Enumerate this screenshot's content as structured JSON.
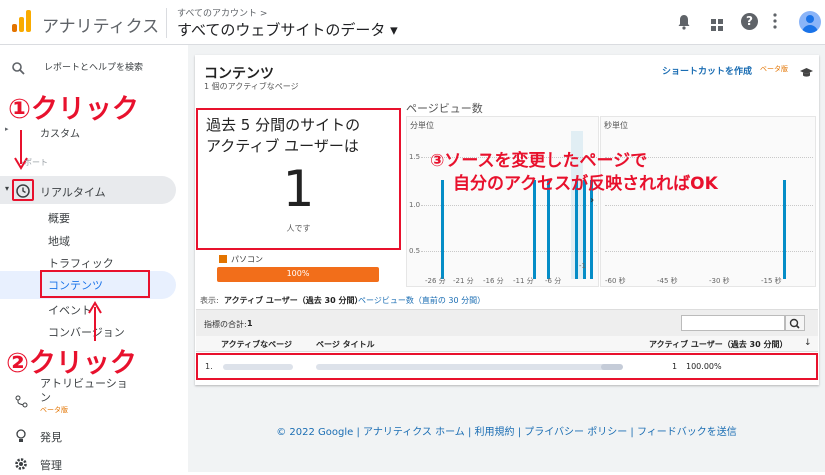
{
  "header": {
    "app_name": "アナリティクス",
    "account_path": "すべてのアカウント >",
    "property_name": "すべてのウェブサイトのデータ ▾"
  },
  "sidebar": {
    "search_label": "レポートとヘルプを検索",
    "custom_label": "カスタム",
    "report_section": "レポート",
    "realtime_label": "リアルタイム",
    "items": [
      "概要",
      "地域",
      "トラフィック",
      "コンテンツ",
      "イベント",
      "コンバージョン"
    ],
    "attribution_label": "アトリビューション",
    "beta_badge": "ベータ版",
    "discover_label": "発見",
    "admin_label": "管理"
  },
  "annotations": {
    "click1": "①クリック",
    "click2": "②クリック",
    "note3_line1": "③ソースを変更したページで",
    "note3_line2": "自分のアクセスが反映されればOK"
  },
  "content": {
    "title": "コンテンツ",
    "subtitle": "1 個のアクティブなページ",
    "shortcut_label": "ショートカットを作成",
    "shortcut_beta": "ベータ版",
    "active_box_line1": "過去 5 分間のサイトの",
    "active_box_line2": "アクティブ ユーザーは",
    "active_count": "1",
    "active_unit": "人です",
    "device_label": "パソコン",
    "device_percent": "100%",
    "pageview_title": "ページビュー数",
    "chart_min_label": "分単位",
    "chart_sec_label": "秒単位",
    "min_yticks": [
      "1.5",
      "1.0",
      "0.5"
    ],
    "min_xticks": [
      "-26 分",
      "-21 分",
      "-16 分",
      "-11 分",
      "-6 分",
      "-1"
    ],
    "sec_xticks": [
      "-60 秒",
      "-45 秒",
      "-30 秒",
      "-15 秒"
    ],
    "view_prefix": "表示:",
    "view_active": "アクティブ ユーザー（過去 30 分間）",
    "view_pageviews": "ページビュー数（直前の 30 分間）",
    "metric_total_label": "指標の合計:",
    "metric_total_value": "1",
    "col_page": "アクティブなページ",
    "col_title": "ページ タイトル",
    "col_users": "アクティブ ユーザー（過去 30 分間）",
    "row_index": "1.",
    "row_users": "1",
    "row_percent": "100.00%"
  },
  "chart_data": [
    {
      "type": "bar",
      "title": "分単位",
      "x": [
        "-26 分",
        "-21 分",
        "-16 分",
        "-11 分",
        "-6 分",
        "-1"
      ],
      "series": [
        {
          "values": [
            1,
            1,
            1,
            1,
            1,
            1
          ]
        }
      ],
      "ylim": [
        0,
        1.5
      ]
    },
    {
      "type": "bar",
      "title": "秒単位",
      "x": [
        "-60 秒",
        "-45 秒",
        "-30 秒",
        "-15 秒"
      ],
      "series": [
        {
          "values": [
            1
          ]
        }
      ],
      "ylim": [
        0,
        1.5
      ]
    }
  ],
  "footer": {
    "text": "© 2022 Google | アナリティクス ホーム | 利用規約 | プライバシー ポリシー | フィードバックを送信"
  },
  "colors": {
    "accent": "#e8112d",
    "bar": "#058dc7",
    "orange": "#f26e1a"
  }
}
